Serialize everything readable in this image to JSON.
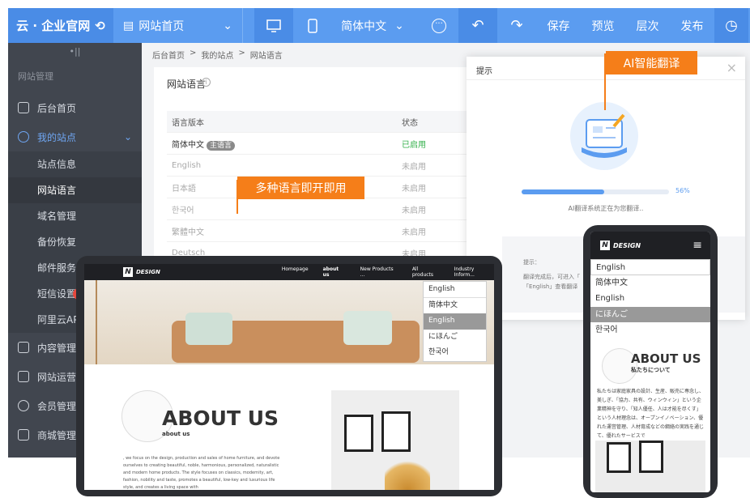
{
  "topbar": {
    "brand": "云 · 企业官网",
    "page_selector": "网站首页",
    "language_selector": "简体中文",
    "actions": [
      "保存",
      "预览",
      "层次",
      "发布"
    ]
  },
  "sidebar": {
    "collapse": "•||",
    "section_title": "网站管理",
    "items": [
      {
        "label": "后台首页"
      },
      {
        "label": "我的站点"
      },
      {
        "label": "站点信息"
      },
      {
        "label": "网站语言"
      },
      {
        "label": "域名管理"
      },
      {
        "label": "备份恢复"
      },
      {
        "label": "邮件服务器"
      },
      {
        "label": "短信设置"
      },
      {
        "label": "阿里云API调"
      },
      {
        "label": "内容管理"
      },
      {
        "label": "网站运营"
      },
      {
        "label": "会员管理"
      },
      {
        "label": "商城管理"
      }
    ]
  },
  "breadcrumb": [
    "后台首页",
    ">",
    "我的站点",
    ">",
    "网站语言"
  ],
  "lang_panel": {
    "title": "网站语言",
    "info": "i",
    "headers": [
      "语言版本",
      "状态"
    ],
    "rows": [
      {
        "name": "简体中文",
        "tag": "主语言",
        "status": "已启用"
      },
      {
        "name": "English",
        "status": "未启用"
      },
      {
        "name": "日本語",
        "status": "未启用"
      },
      {
        "name": "한국어",
        "status": "未启用"
      },
      {
        "name": "繁體中文",
        "status": "未启用"
      },
      {
        "name": "Deutsch",
        "status": "未启用"
      }
    ]
  },
  "dialog": {
    "title": "提示",
    "close": "×",
    "progress": 0.56,
    "progress_label": "56%",
    "progress_text": "AI翻译系统正在为您翻译..",
    "tip_title": "提示：",
    "tip_lines": [
      "翻译完成后，可进入「",
      "「English」查看翻译"
    ]
  },
  "callouts": {
    "ai": "AI智能翻译",
    "multi": "多种语言即开即用"
  },
  "tablet": {
    "logo": "DESIGN",
    "logo_mark": "N",
    "nav": [
      "Homepage",
      "about us",
      "New Products ...",
      "All products",
      "Industry Inform..."
    ],
    "dropdown": [
      "English",
      "简体中文",
      "English",
      "にほんご",
      "한국어"
    ],
    "about_title": "ABOUT US",
    "about_sub": "about us",
    "paragraph": ", we focus on the design, production and sales of home furniture, and devote ourselves to creating beautiful, noble, harmonious, personalized, naturalistic and modern home products. The style focuses on classics, modernity, art, fashion, nobility and taste, promotes a beautiful, low-key and luxurious life style, and creates a living space with"
  },
  "phone": {
    "logo": "DESIGN",
    "logo_mark": "N",
    "menu": "≡",
    "dropdown": [
      "English",
      "简体中文",
      "English",
      "にほんご",
      "한국어"
    ],
    "about_title": "ABOUT US",
    "about_sub": "私たちについて",
    "paragraph": "私たちは家庭家具の設計、生産、販売に専念し、美しぎ、「協力、共有、ウィンウィン」という企業精神を守り、「知人優任、人は才能を尽くす」という人材理念は、オープンイノベーション、優れた運営管理、人材育成などの綱絡の実践を通じて、優れたサービスで"
  },
  "colors": {
    "accent": "#5b9cf0",
    "callout": "#f57e19",
    "sidebar": "#41464f",
    "enabled": "#33b04a"
  }
}
